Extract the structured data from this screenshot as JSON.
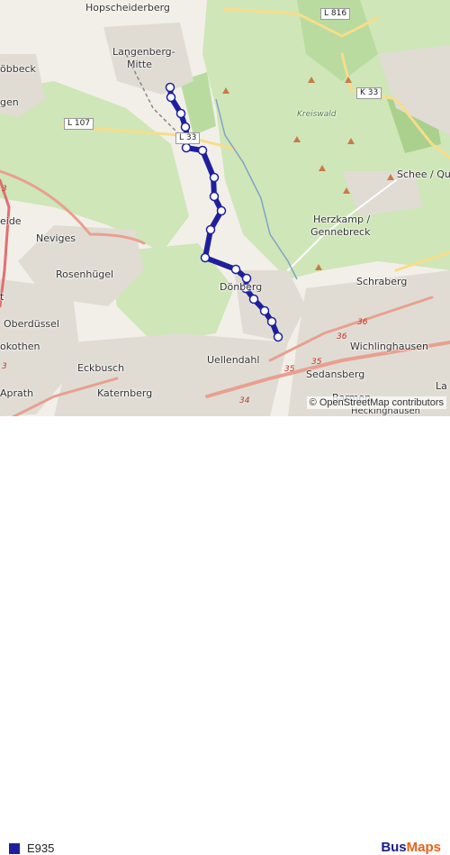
{
  "map": {
    "places": [
      {
        "id": "hopscheiderberg",
        "label": "Hopscheiderberg"
      },
      {
        "id": "langenberg",
        "label": "Langenberg-"
      },
      {
        "id": "langenberg2",
        "label": "Mitte"
      },
      {
        "id": "bbeck",
        "label": "öbbeck"
      },
      {
        "id": "gen",
        "label": "gen"
      },
      {
        "id": "neviges",
        "label": "Neviges"
      },
      {
        "id": "rosenhugel",
        "label": "Rosenhügel"
      },
      {
        "id": "oberdussel",
        "label": "Oberdüssel"
      },
      {
        "id": "kothen",
        "label": "okothen"
      },
      {
        "id": "eckbusch",
        "label": "Eckbusch"
      },
      {
        "id": "aprath",
        "label": "Aprath"
      },
      {
        "id": "katernberg",
        "label": "Katernberg"
      },
      {
        "id": "uellendahl",
        "label": "Uellendahl"
      },
      {
        "id": "dornberg",
        "label": "Dönberg"
      },
      {
        "id": "herzkamp",
        "label": "Herzkamp /"
      },
      {
        "id": "herzkamp2",
        "label": "Gennebreck"
      },
      {
        "id": "schee",
        "label": "Schee / Que"
      },
      {
        "id": "schraberg",
        "label": "Schraberg"
      },
      {
        "id": "wichlinghausen",
        "label": "Wichlinghausen"
      },
      {
        "id": "sedansberg",
        "label": "Sedansberg"
      },
      {
        "id": "barmen",
        "label": "Barmen"
      },
      {
        "id": "heckinghausen",
        "label": "Heckinghausen"
      },
      {
        "id": "eide",
        "label": "eide"
      },
      {
        "id": "t",
        "label": "t"
      },
      {
        "id": "la",
        "label": "La"
      }
    ],
    "forest_label": "Kreiswald",
    "roads": [
      {
        "id": "l816",
        "label": "L 816"
      },
      {
        "id": "k33",
        "label": "K 33"
      },
      {
        "id": "l107",
        "label": "L 107"
      },
      {
        "id": "l33",
        "label": "L 33"
      }
    ],
    "route_numbers": [
      "36",
      "36",
      "35",
      "35",
      "34",
      "3",
      "3"
    ],
    "attribution": "© OpenStreetMap contributors",
    "route": {
      "name": "E935",
      "color": "#1f1f9e",
      "stops": 16
    }
  },
  "legend": {
    "route_label": "E935",
    "color": "#1f1f9e"
  },
  "brand": {
    "part1": "Bus",
    "part2": "Maps"
  }
}
